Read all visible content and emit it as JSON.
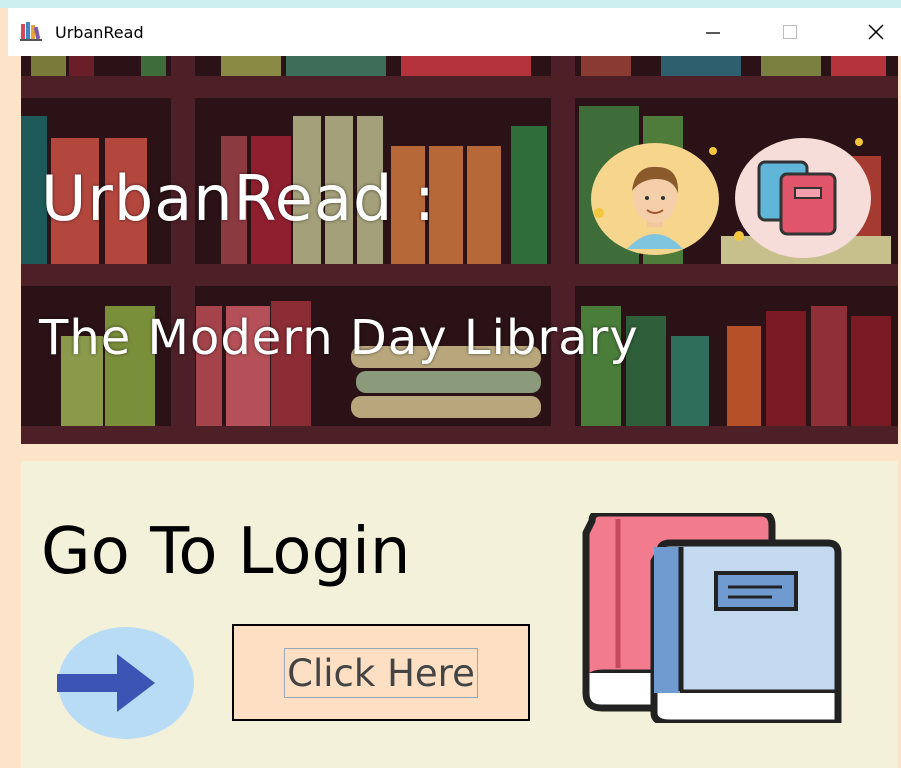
{
  "window": {
    "title": "UrbanRead",
    "icon": "books-app-icon",
    "controls": [
      "minimize",
      "maximize",
      "close"
    ]
  },
  "hero": {
    "title": "UrbanRead :",
    "subtitle": "The Modern Day Library",
    "background": "bookshelf-illustration",
    "icons": [
      "user-avatar-icon",
      "books-icon"
    ]
  },
  "login": {
    "heading": "Go To Login",
    "button_label": "Click Here",
    "arrow_icon": "arrow-right-icon",
    "illustration": "books-illustration"
  },
  "colors": {
    "window_bg": "#fde3c8",
    "panel_bg": "#f4f1da",
    "button_bg": "#fde0c4",
    "arrow_circle": "#b9dcf6",
    "arrow": "#3c54b4"
  }
}
